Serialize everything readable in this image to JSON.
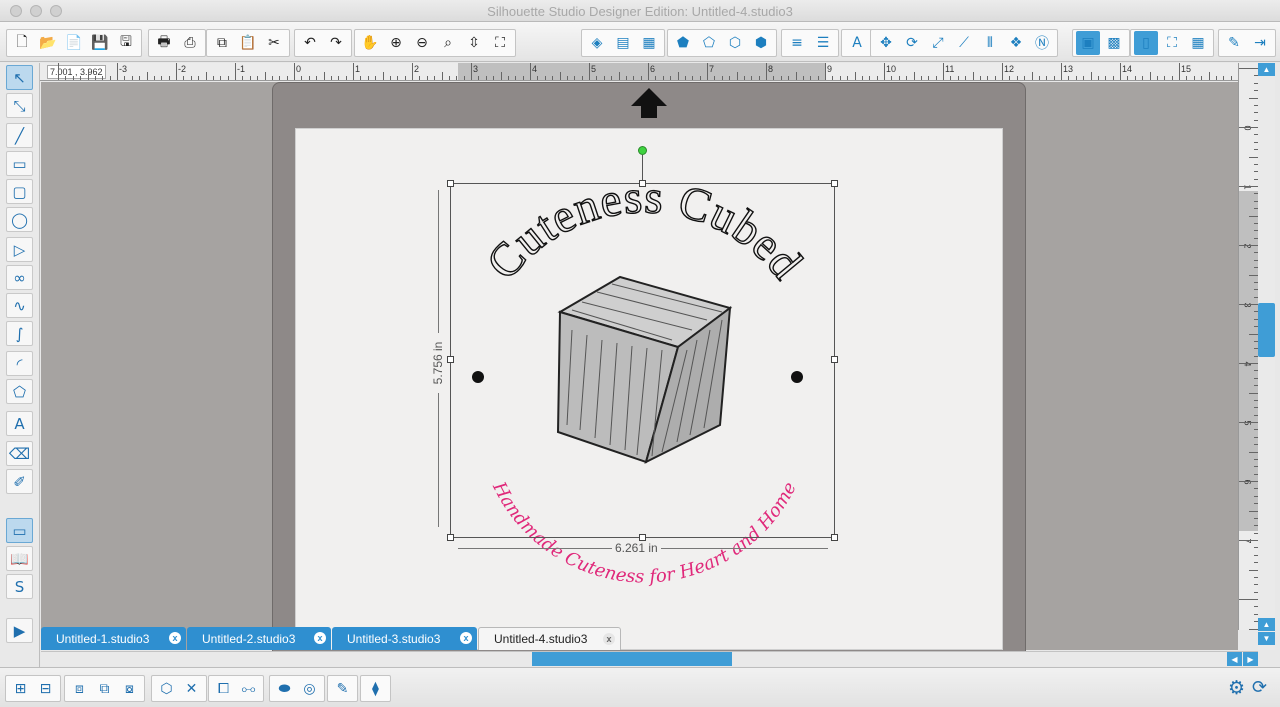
{
  "window": {
    "title": "Silhouette Studio Designer Edition: Untitled-4.studio3"
  },
  "toolbar": {
    "groups": [
      {
        "icons": [
          "new-file-icon",
          "open-file-icon",
          "library-icon",
          "save-icon",
          "save-as-icon"
        ],
        "glyphs": [
          "🗋",
          "📂",
          "📄",
          "💾",
          "🖫"
        ]
      },
      {
        "icons": [
          "print-icon",
          "send-print-icon"
        ],
        "glyphs": [
          "🖶",
          "⎙"
        ]
      },
      {
        "icons": [
          "copy-icon",
          "paste-icon",
          "cut-icon"
        ],
        "glyphs": [
          "⧉",
          "📋",
          "✂"
        ]
      },
      {
        "icons": [
          "undo-icon",
          "redo-icon"
        ],
        "glyphs": [
          "↶",
          "↷"
        ]
      },
      {
        "icons": [
          "pan-icon",
          "zoom-in-icon",
          "zoom-out-icon",
          "zoom-select-icon",
          "drag-zoom-icon",
          "fit-page-icon"
        ],
        "glyphs": [
          "✋",
          "⊕",
          "⊖",
          "⌕",
          "⇳",
          "⛶"
        ]
      },
      {
        "icons": [
          "fill-color-icon",
          "gradient-icon",
          "pattern-icon"
        ],
        "glyphs": [
          "◈",
          "▤",
          "▦"
        ]
      },
      {
        "icons": [
          "line-color-icon",
          "line-style-icon",
          "shadow-icon",
          "sketch-icon"
        ],
        "glyphs": [
          "⬟",
          "⬠",
          "⬡",
          "⬢"
        ]
      },
      {
        "icons": [
          "line-width-icon",
          "line-dash-icon"
        ],
        "glyphs": [
          "≡",
          "☰"
        ]
      },
      {
        "icons": [
          "text-style-icon"
        ],
        "glyphs": [
          "A"
        ]
      },
      {
        "icons": [
          "transform-icon",
          "rotate-icon",
          "scale-icon",
          "shear-icon",
          "align-icon",
          "replicate-icon",
          "nest-icon"
        ],
        "glyphs": [
          "✥",
          "⟳",
          "⤢",
          "⟋",
          "⫴",
          "❖",
          "Ⓝ"
        ]
      },
      {
        "icons": [
          "offset-icon",
          "trace-icon"
        ],
        "glyphs": [
          "▣",
          "▩"
        ]
      },
      {
        "icons": [
          "page-setup-icon",
          "registration-icon",
          "grid-icon"
        ],
        "glyphs": [
          "▯",
          "⛶",
          "▦"
        ]
      },
      {
        "icons": [
          "send-silhouette-icon",
          "silhouette-store-icon"
        ],
        "glyphs": [
          "✎",
          "⇥"
        ]
      }
    ],
    "active": [
      "page-setup-icon",
      "offset-icon"
    ]
  },
  "left_tools": [
    {
      "name": "select-tool-icon",
      "glyph": "↖",
      "active": true
    },
    {
      "name": "edit-points-icon",
      "glyph": "⤡"
    },
    {
      "name": "line-tool-icon",
      "glyph": "╱"
    },
    {
      "name": "rectangle-tool-icon",
      "glyph": "▭"
    },
    {
      "name": "rounded-rect-tool-icon",
      "glyph": "▢"
    },
    {
      "name": "ellipse-tool-icon",
      "glyph": "◯"
    },
    {
      "name": "polygon-tool-icon",
      "glyph": "▷"
    },
    {
      "name": "curve-tool-icon",
      "glyph": "∞"
    },
    {
      "name": "freehand-tool-icon",
      "glyph": "∿"
    },
    {
      "name": "smooth-freehand-icon",
      "glyph": "∫"
    },
    {
      "name": "arc-tool-icon",
      "glyph": "◜"
    },
    {
      "name": "regular-polygon-icon",
      "glyph": "⬠"
    },
    {
      "name": "text-tool-icon",
      "glyph": "A"
    },
    {
      "name": "eraser-tool-icon",
      "glyph": "⌫"
    },
    {
      "name": "knife-tool-icon",
      "glyph": "✐"
    },
    {
      "name": "design-page-icon",
      "glyph": "▭",
      "active": true
    },
    {
      "name": "library-panel-icon",
      "glyph": "📖"
    },
    {
      "name": "online-store-icon",
      "glyph": "S"
    },
    {
      "name": "expand-panel-icon",
      "glyph": "▶"
    }
  ],
  "ruler": {
    "coords": "7.001 , 3.962",
    "h_labels": [
      "-3",
      "-2",
      "-1",
      "0",
      "1",
      "2",
      "3",
      "4",
      "5",
      "6",
      "7",
      "8",
      "9",
      "10",
      "11",
      "12",
      "13",
      "14",
      "15"
    ],
    "v_labels": [
      "0",
      "1",
      "2",
      "3",
      "4",
      "5",
      "6",
      "7"
    ]
  },
  "design": {
    "arc_title": "Cuteness Cubed",
    "arc_subtitle": "Handmade Cuteness for Heart and Home",
    "height_label": "5.756 in",
    "width_label": "6.261 in",
    "title_color": "#111111",
    "subtitle_color": "#e0287a"
  },
  "tabs": [
    {
      "label": "Untitled-1.studio3",
      "close": "x",
      "active": false
    },
    {
      "label": "Untitled-2.studio3",
      "close": "x",
      "active": false
    },
    {
      "label": "Untitled-3.studio3",
      "close": "x",
      "active": false
    },
    {
      "label": "Untitled-4.studio3",
      "close": "x",
      "active": true
    }
  ],
  "bottom_tools": [
    {
      "icons": [
        "group-icon",
        "ungroup-icon"
      ],
      "glyphs": [
        "⊞",
        "⊟"
      ]
    },
    {
      "icons": [
        "compound-path-icon",
        "release-compound-icon",
        "weld-icon"
      ],
      "glyphs": [
        "⧈",
        "⧉",
        "⧇"
      ]
    },
    {
      "icons": [
        "3d-icon",
        "crop-icon"
      ],
      "glyphs": [
        "⬡",
        "✕"
      ]
    },
    {
      "icons": [
        "bring-forward-icon",
        "send-backward-icon"
      ],
      "glyphs": [
        "⧠",
        "⧟"
      ]
    },
    {
      "icons": [
        "fill-pattern-icon",
        "offset-ring-icon"
      ],
      "glyphs": [
        "⬬",
        "◎"
      ]
    },
    {
      "icons": [
        "trace-bottom-icon"
      ],
      "glyphs": [
        "✎"
      ]
    },
    {
      "icons": [
        "cut-settings-icon"
      ],
      "glyphs": [
        "⧫"
      ]
    }
  ],
  "status_icons": [
    "settings-gear-icon",
    "sync-icon"
  ]
}
